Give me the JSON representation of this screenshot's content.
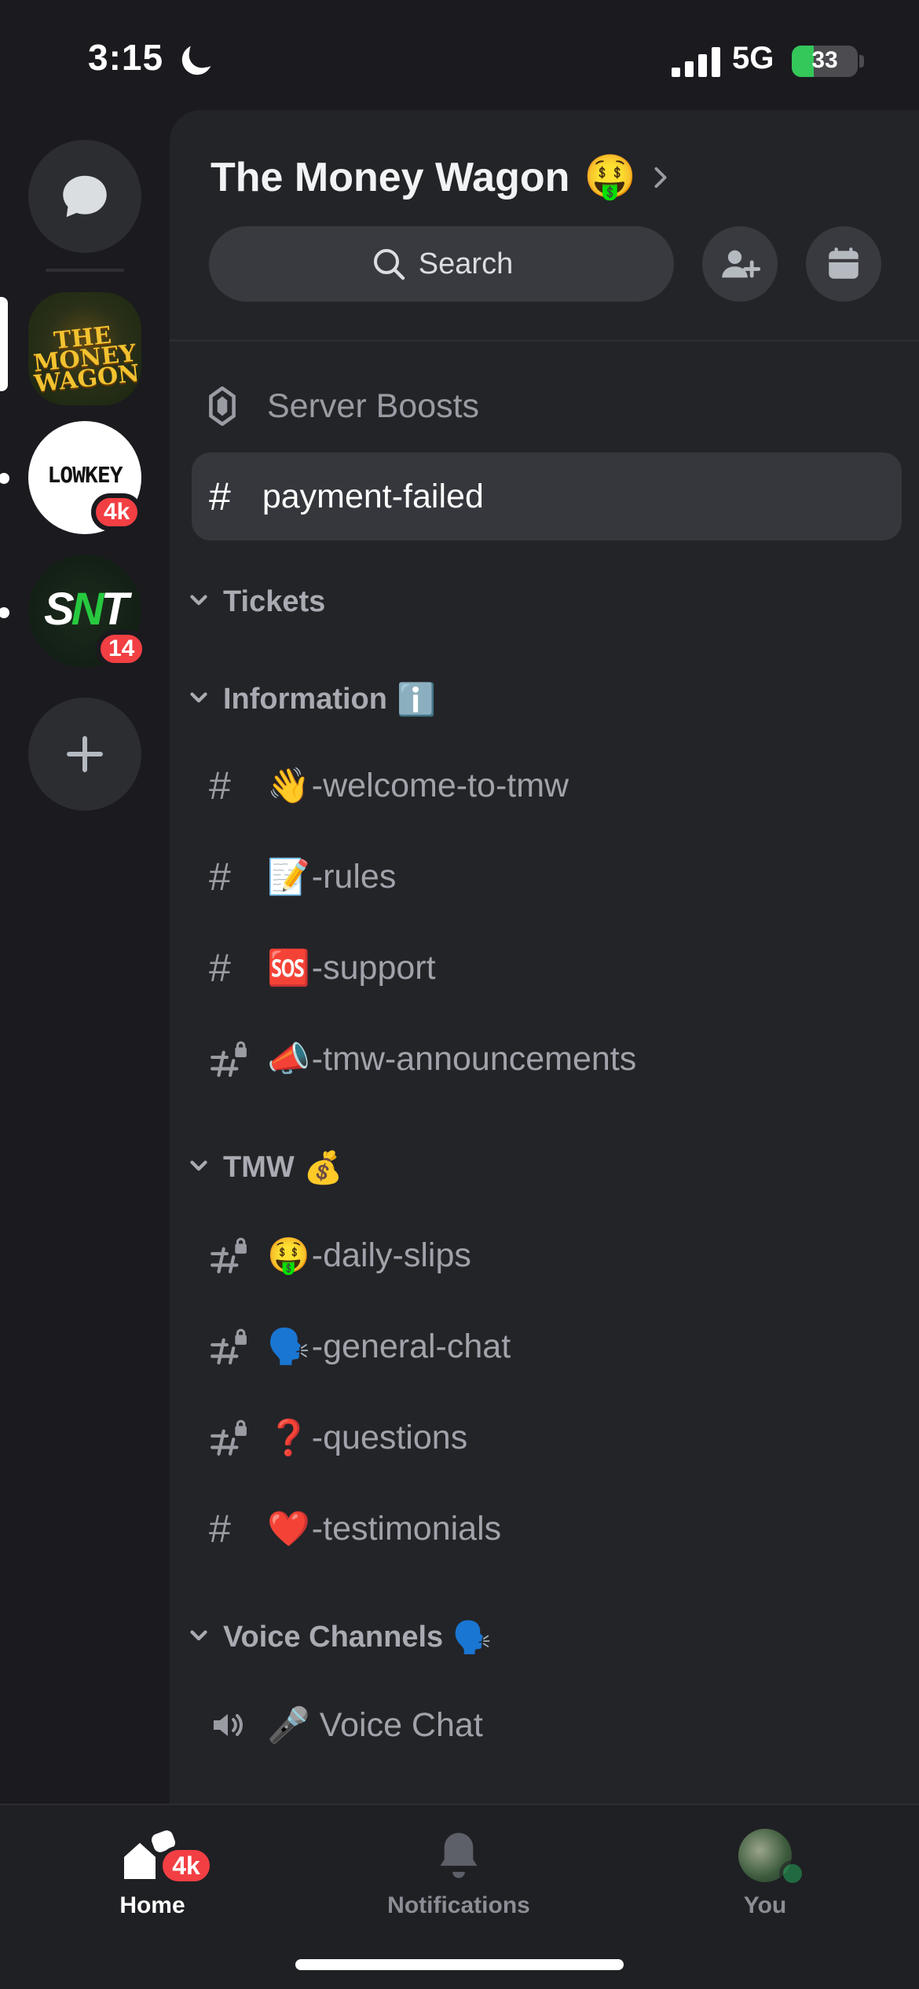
{
  "status_bar": {
    "time": "3:15",
    "network": "5G",
    "battery": "33",
    "battery_level": 0.33
  },
  "rail": {
    "servers": [
      {
        "name": "The Money Wagon",
        "logo_text_1": "THE",
        "logo_text_2": "MONEY",
        "logo_text_3": "WAGON"
      },
      {
        "logo_text": "LOWKEY",
        "badge": "4k"
      },
      {
        "logo_text_1": "S",
        "logo_text_2": "N",
        "logo_text_3": "T",
        "badge": "14"
      }
    ]
  },
  "header": {
    "server_name": "The Money Wagon",
    "server_emoji": "🤑",
    "search_label": "Search"
  },
  "channels": {
    "server_boosts": "Server Boosts",
    "selected": "payment-failed",
    "categories": [
      {
        "label": "Tickets",
        "emoji": ""
      },
      {
        "label": "Information",
        "emoji": "ℹ️"
      },
      {
        "label": "TMW",
        "emoji": "💰"
      },
      {
        "label": "Voice Channels",
        "emoji": "🗣️"
      }
    ],
    "information": [
      {
        "emoji": "👋",
        "name": "-welcome-to-tmw",
        "locked": false
      },
      {
        "emoji": "📝",
        "name": "-rules",
        "locked": false
      },
      {
        "emoji": "🆘",
        "name": "-support",
        "locked": false
      },
      {
        "emoji": "📣",
        "name": "-tmw-announcements",
        "locked": true
      }
    ],
    "tmw": [
      {
        "emoji": "🤑",
        "name": "-daily-slips",
        "locked": true
      },
      {
        "emoji": "🗣️",
        "name": "-general-chat",
        "locked": true
      },
      {
        "emoji": "❓",
        "name": "-questions",
        "locked": true
      },
      {
        "emoji": "❤️",
        "name": "-testimonials",
        "locked": false
      }
    ],
    "voice": [
      {
        "emoji": "🎤",
        "name": "Voice Chat"
      }
    ]
  },
  "bottom_nav": {
    "home_label": "Home",
    "home_badge": "4k",
    "notifications_label": "Notifications",
    "you_label": "You"
  },
  "colors": {
    "background": "#1a1a1f",
    "panel": "#232428",
    "badge_red": "#f23f43",
    "online_green": "#23a55a",
    "battery_green": "#34c759"
  }
}
